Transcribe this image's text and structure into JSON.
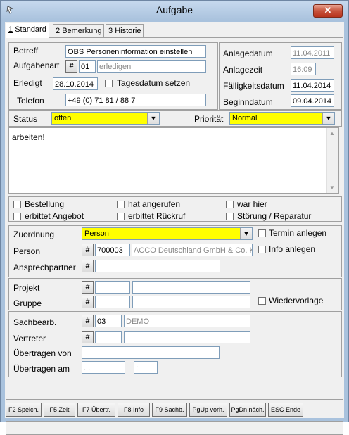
{
  "window": {
    "title": "Aufgabe",
    "close_glyph": "✕"
  },
  "tabs": [
    {
      "num": "1",
      "label": "Standard"
    },
    {
      "num": "2",
      "label": "Bemerkung"
    },
    {
      "num": "3",
      "label": "Historie"
    }
  ],
  "form": {
    "betreff_label": "Betreff",
    "betreff_value": "OBS Personeninformation einstellen",
    "aufgabenart_label": "Aufgabenart",
    "aufgabenart_code": "01",
    "aufgabenart_text": "erledigen",
    "erledigt_label": "Erledigt",
    "erledigt_value": "28.10.2014",
    "tagesdatum_label": "Tagesdatum setzen",
    "telefon_label": "Telefon",
    "telefon_value": "+49 (0) 71 81 / 88 7",
    "anlagedatum_label": "Anlagedatum",
    "anlagedatum_value": "11.04.2011",
    "anlagezeit_label": "Anlagezeit",
    "anlagezeit_value": "16:09",
    "faelligkeitsdatum_label": "Fälligkeitsdatum",
    "faelligkeitsdatum_value": "11.04.2014",
    "beginndatum_label": "Beginndatum",
    "beginndatum_value": "09.04.2014",
    "status_label": "Status",
    "status_value": "offen",
    "prioritaet_label": "Priorität",
    "prioritaet_value": "Normal",
    "memo_text": "arbeiten!",
    "checks": {
      "bestellung": "Bestellung",
      "hat_angerufen": "hat angerufen",
      "war_hier": "war hier",
      "erbittet_angebot": "erbittet Angebot",
      "erbittet_rueckruf": "erbittet Rückruf",
      "stoerung": "Störung / Reparatur"
    },
    "zuordnung_label": "Zuordnung",
    "zuordnung_value": "Person",
    "termin_label": "Termin anlegen",
    "info_label": "Info anlegen",
    "person_label": "Person",
    "person_code": "700003",
    "person_name": "ACCO Deutschland GmbH & Co. KG",
    "ansprechpartner_label": "Ansprechpartner",
    "projekt_label": "Projekt",
    "gruppe_label": "Gruppe",
    "wiedervorlage_label": "Wiedervorlage",
    "sachbearb_label": "Sachbearb.",
    "sachbearb_code": "03",
    "sachbearb_name": "DEMO",
    "vertreter_label": "Vertreter",
    "uebertragen_von_label": "Übertragen von",
    "uebertragen_am_label": "Übertragen am",
    "uebertragen_am_date": " .  .",
    "uebertragen_am_time": ":",
    "hash_glyph": "#"
  },
  "fkeys": [
    "F2 Speich.",
    "F5 Zeit",
    "F7 Übertr.",
    "F8 Info",
    "F9 Sachb.",
    "PgUp vorh.",
    "PgDn näch.",
    "ESC Ende"
  ]
}
